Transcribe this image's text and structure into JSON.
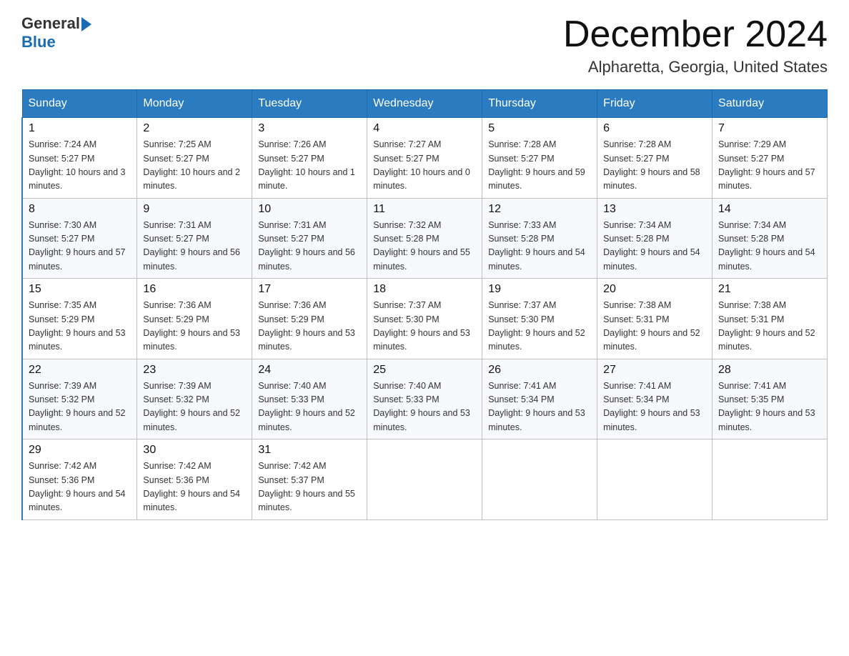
{
  "header": {
    "logo_general": "General",
    "logo_blue": "Blue",
    "title": "December 2024",
    "subtitle": "Alpharetta, Georgia, United States"
  },
  "columns": [
    "Sunday",
    "Monday",
    "Tuesday",
    "Wednesday",
    "Thursday",
    "Friday",
    "Saturday"
  ],
  "weeks": [
    [
      {
        "day": "1",
        "sunrise": "7:24 AM",
        "sunset": "5:27 PM",
        "daylight": "10 hours and 3 minutes."
      },
      {
        "day": "2",
        "sunrise": "7:25 AM",
        "sunset": "5:27 PM",
        "daylight": "10 hours and 2 minutes."
      },
      {
        "day": "3",
        "sunrise": "7:26 AM",
        "sunset": "5:27 PM",
        "daylight": "10 hours and 1 minute."
      },
      {
        "day": "4",
        "sunrise": "7:27 AM",
        "sunset": "5:27 PM",
        "daylight": "10 hours and 0 minutes."
      },
      {
        "day": "5",
        "sunrise": "7:28 AM",
        "sunset": "5:27 PM",
        "daylight": "9 hours and 59 minutes."
      },
      {
        "day": "6",
        "sunrise": "7:28 AM",
        "sunset": "5:27 PM",
        "daylight": "9 hours and 58 minutes."
      },
      {
        "day": "7",
        "sunrise": "7:29 AM",
        "sunset": "5:27 PM",
        "daylight": "9 hours and 57 minutes."
      }
    ],
    [
      {
        "day": "8",
        "sunrise": "7:30 AM",
        "sunset": "5:27 PM",
        "daylight": "9 hours and 57 minutes."
      },
      {
        "day": "9",
        "sunrise": "7:31 AM",
        "sunset": "5:27 PM",
        "daylight": "9 hours and 56 minutes."
      },
      {
        "day": "10",
        "sunrise": "7:31 AM",
        "sunset": "5:27 PM",
        "daylight": "9 hours and 56 minutes."
      },
      {
        "day": "11",
        "sunrise": "7:32 AM",
        "sunset": "5:28 PM",
        "daylight": "9 hours and 55 minutes."
      },
      {
        "day": "12",
        "sunrise": "7:33 AM",
        "sunset": "5:28 PM",
        "daylight": "9 hours and 54 minutes."
      },
      {
        "day": "13",
        "sunrise": "7:34 AM",
        "sunset": "5:28 PM",
        "daylight": "9 hours and 54 minutes."
      },
      {
        "day": "14",
        "sunrise": "7:34 AM",
        "sunset": "5:28 PM",
        "daylight": "9 hours and 54 minutes."
      }
    ],
    [
      {
        "day": "15",
        "sunrise": "7:35 AM",
        "sunset": "5:29 PM",
        "daylight": "9 hours and 53 minutes."
      },
      {
        "day": "16",
        "sunrise": "7:36 AM",
        "sunset": "5:29 PM",
        "daylight": "9 hours and 53 minutes."
      },
      {
        "day": "17",
        "sunrise": "7:36 AM",
        "sunset": "5:29 PM",
        "daylight": "9 hours and 53 minutes."
      },
      {
        "day": "18",
        "sunrise": "7:37 AM",
        "sunset": "5:30 PM",
        "daylight": "9 hours and 53 minutes."
      },
      {
        "day": "19",
        "sunrise": "7:37 AM",
        "sunset": "5:30 PM",
        "daylight": "9 hours and 52 minutes."
      },
      {
        "day": "20",
        "sunrise": "7:38 AM",
        "sunset": "5:31 PM",
        "daylight": "9 hours and 52 minutes."
      },
      {
        "day": "21",
        "sunrise": "7:38 AM",
        "sunset": "5:31 PM",
        "daylight": "9 hours and 52 minutes."
      }
    ],
    [
      {
        "day": "22",
        "sunrise": "7:39 AM",
        "sunset": "5:32 PM",
        "daylight": "9 hours and 52 minutes."
      },
      {
        "day": "23",
        "sunrise": "7:39 AM",
        "sunset": "5:32 PM",
        "daylight": "9 hours and 52 minutes."
      },
      {
        "day": "24",
        "sunrise": "7:40 AM",
        "sunset": "5:33 PM",
        "daylight": "9 hours and 52 minutes."
      },
      {
        "day": "25",
        "sunrise": "7:40 AM",
        "sunset": "5:33 PM",
        "daylight": "9 hours and 53 minutes."
      },
      {
        "day": "26",
        "sunrise": "7:41 AM",
        "sunset": "5:34 PM",
        "daylight": "9 hours and 53 minutes."
      },
      {
        "day": "27",
        "sunrise": "7:41 AM",
        "sunset": "5:34 PM",
        "daylight": "9 hours and 53 minutes."
      },
      {
        "day": "28",
        "sunrise": "7:41 AM",
        "sunset": "5:35 PM",
        "daylight": "9 hours and 53 minutes."
      }
    ],
    [
      {
        "day": "29",
        "sunrise": "7:42 AM",
        "sunset": "5:36 PM",
        "daylight": "9 hours and 54 minutes."
      },
      {
        "day": "30",
        "sunrise": "7:42 AM",
        "sunset": "5:36 PM",
        "daylight": "9 hours and 54 minutes."
      },
      {
        "day": "31",
        "sunrise": "7:42 AM",
        "sunset": "5:37 PM",
        "daylight": "9 hours and 55 minutes."
      },
      null,
      null,
      null,
      null
    ]
  ]
}
